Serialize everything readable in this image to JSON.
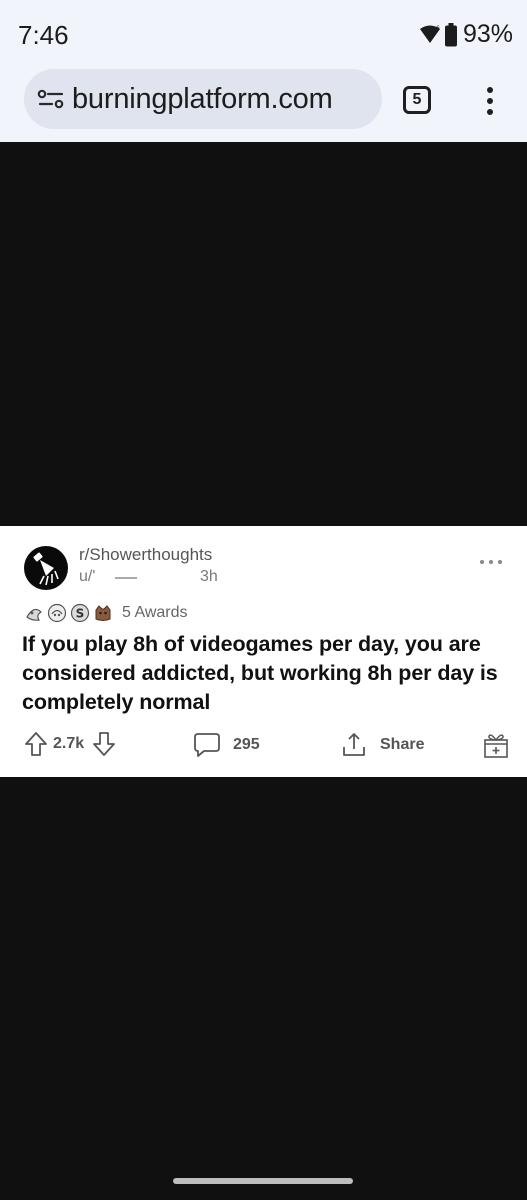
{
  "status_bar": {
    "time": "7:46",
    "battery": "93%",
    "icons": [
      "wifi-icon",
      "battery-icon"
    ]
  },
  "browser": {
    "url": "burningplatform.com",
    "tab_count": "5",
    "icons": [
      "site-info-icon",
      "tabs-icon",
      "more-vert-icon"
    ]
  },
  "post": {
    "subreddit": "r/Showerthoughts",
    "user": "u/'",
    "time": "3h",
    "awards_label": "5 Awards",
    "title": "If you play 8h of videogames per day, you are considered addicted, but working 8h per day is completely normal",
    "upvotes": "2.7k",
    "comments": "295",
    "share_label": "Share",
    "icons": [
      "subreddit-avatar-icon",
      "upvote-icon",
      "downvote-icon",
      "comment-icon",
      "share-icon",
      "gift-icon"
    ]
  },
  "colors": {
    "status_bg": "#f1f4fa",
    "url_pill": "#dfe4ee",
    "page_bg": "#101010",
    "card_bg": "#ffffff"
  }
}
